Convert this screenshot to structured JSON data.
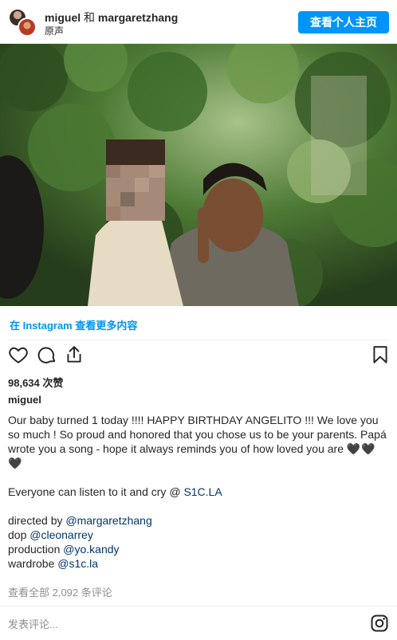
{
  "header": {
    "user1": "miguel",
    "joiner": "和",
    "user2": "margaretzhang",
    "audio": "原声",
    "profile_button": "查看个人主页"
  },
  "photo": {
    "icon": "photo-image",
    "colors": {
      "foliage": "#3f6a2c",
      "skin": "#8a5a3c",
      "blur": "#a58a78"
    }
  },
  "view_more": "在 Instagram 查看更多内容",
  "actions": {
    "icons": [
      "heart-icon",
      "comment-icon",
      "share-icon",
      "bookmark-icon"
    ]
  },
  "likes": "98,634 次赞",
  "author": "miguel",
  "caption": {
    "para1": "Our baby turned 1 today !!!! HAPPY BIRTHDAY ANGELITO !!! We love you so much ! So proud and honored that you chose us to be your parents. Papá wrote you a song - hope it always reminds you of how loved you are",
    "hearts": "🖤🖤🖤",
    "para2_text": "Everyone can listen to it and cry @ ",
    "para2_link": "S1C.LA",
    "credits": [
      {
        "role": "directed by ",
        "handle": "@margaretzhang"
      },
      {
        "role": "dop ",
        "handle": "@cleonarrey"
      },
      {
        "role": "production ",
        "handle": "@yo.kandy"
      },
      {
        "role": "wardrobe ",
        "handle": "@s1c.la"
      }
    ]
  },
  "comments_link": "查看全部 2,092 条评论",
  "comment_input": {
    "placeholder": "发表评论..."
  },
  "accent": "#0095f6",
  "link_color": "#00376b"
}
